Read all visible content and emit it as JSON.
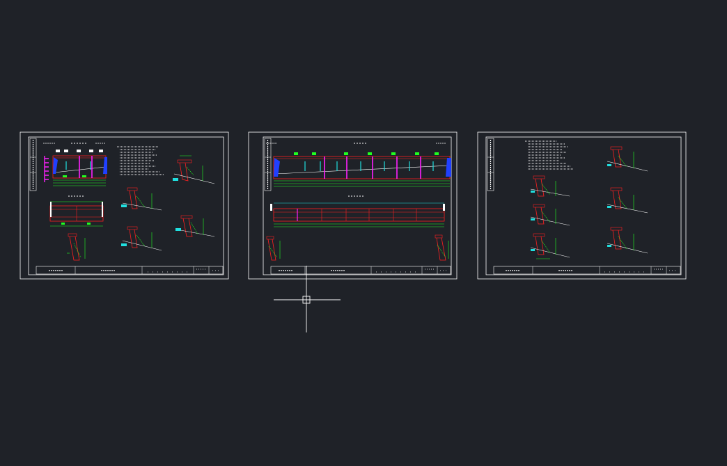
{
  "sheets": [
    {
      "id": "sheet-1"
    },
    {
      "id": "sheet-2"
    },
    {
      "id": "sheet-3"
    }
  ],
  "colors": {
    "background": "#1f2228",
    "frame": "#ffffff",
    "red": "#ff2020",
    "green": "#20ff20",
    "cyan": "#20e0e0",
    "magenta": "#ff20ff",
    "blue": "#2040ff",
    "yellow": "#ffff40"
  },
  "cursor": {
    "type": "crosshair"
  }
}
